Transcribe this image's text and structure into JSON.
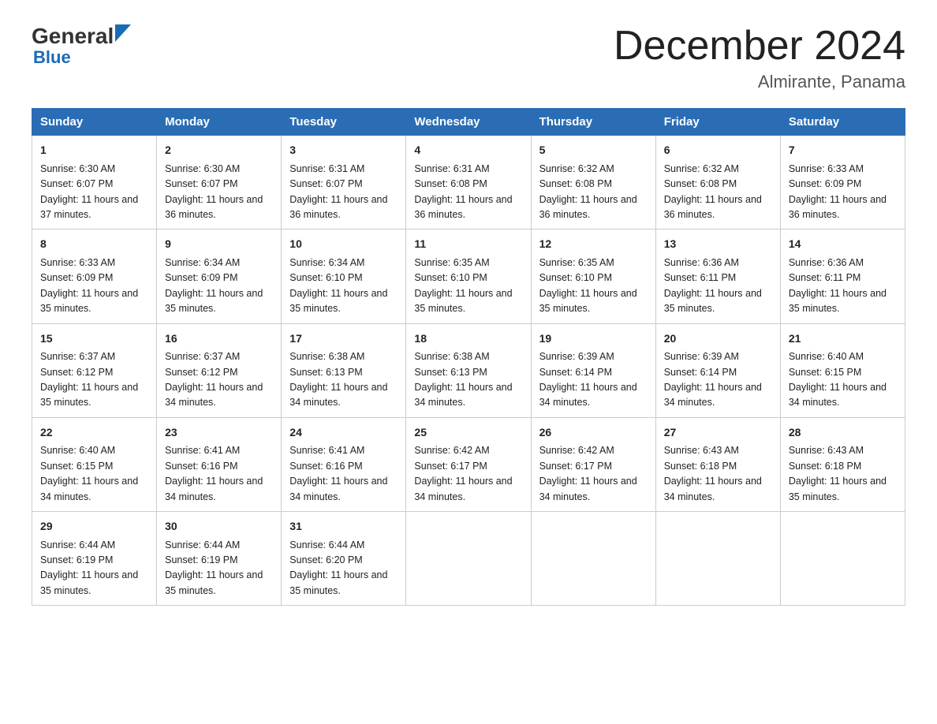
{
  "header": {
    "logo_general": "General",
    "logo_blue": "Blue",
    "month_title": "December 2024",
    "location": "Almirante, Panama"
  },
  "days_of_week": [
    "Sunday",
    "Monday",
    "Tuesday",
    "Wednesday",
    "Thursday",
    "Friday",
    "Saturday"
  ],
  "weeks": [
    [
      {
        "day": "1",
        "sunrise": "6:30 AM",
        "sunset": "6:07 PM",
        "daylight": "11 hours and 37 minutes."
      },
      {
        "day": "2",
        "sunrise": "6:30 AM",
        "sunset": "6:07 PM",
        "daylight": "11 hours and 36 minutes."
      },
      {
        "day": "3",
        "sunrise": "6:31 AM",
        "sunset": "6:07 PM",
        "daylight": "11 hours and 36 minutes."
      },
      {
        "day": "4",
        "sunrise": "6:31 AM",
        "sunset": "6:08 PM",
        "daylight": "11 hours and 36 minutes."
      },
      {
        "day": "5",
        "sunrise": "6:32 AM",
        "sunset": "6:08 PM",
        "daylight": "11 hours and 36 minutes."
      },
      {
        "day": "6",
        "sunrise": "6:32 AM",
        "sunset": "6:08 PM",
        "daylight": "11 hours and 36 minutes."
      },
      {
        "day": "7",
        "sunrise": "6:33 AM",
        "sunset": "6:09 PM",
        "daylight": "11 hours and 36 minutes."
      }
    ],
    [
      {
        "day": "8",
        "sunrise": "6:33 AM",
        "sunset": "6:09 PM",
        "daylight": "11 hours and 35 minutes."
      },
      {
        "day": "9",
        "sunrise": "6:34 AM",
        "sunset": "6:09 PM",
        "daylight": "11 hours and 35 minutes."
      },
      {
        "day": "10",
        "sunrise": "6:34 AM",
        "sunset": "6:10 PM",
        "daylight": "11 hours and 35 minutes."
      },
      {
        "day": "11",
        "sunrise": "6:35 AM",
        "sunset": "6:10 PM",
        "daylight": "11 hours and 35 minutes."
      },
      {
        "day": "12",
        "sunrise": "6:35 AM",
        "sunset": "6:10 PM",
        "daylight": "11 hours and 35 minutes."
      },
      {
        "day": "13",
        "sunrise": "6:36 AM",
        "sunset": "6:11 PM",
        "daylight": "11 hours and 35 minutes."
      },
      {
        "day": "14",
        "sunrise": "6:36 AM",
        "sunset": "6:11 PM",
        "daylight": "11 hours and 35 minutes."
      }
    ],
    [
      {
        "day": "15",
        "sunrise": "6:37 AM",
        "sunset": "6:12 PM",
        "daylight": "11 hours and 35 minutes."
      },
      {
        "day": "16",
        "sunrise": "6:37 AM",
        "sunset": "6:12 PM",
        "daylight": "11 hours and 34 minutes."
      },
      {
        "day": "17",
        "sunrise": "6:38 AM",
        "sunset": "6:13 PM",
        "daylight": "11 hours and 34 minutes."
      },
      {
        "day": "18",
        "sunrise": "6:38 AM",
        "sunset": "6:13 PM",
        "daylight": "11 hours and 34 minutes."
      },
      {
        "day": "19",
        "sunrise": "6:39 AM",
        "sunset": "6:14 PM",
        "daylight": "11 hours and 34 minutes."
      },
      {
        "day": "20",
        "sunrise": "6:39 AM",
        "sunset": "6:14 PM",
        "daylight": "11 hours and 34 minutes."
      },
      {
        "day": "21",
        "sunrise": "6:40 AM",
        "sunset": "6:15 PM",
        "daylight": "11 hours and 34 minutes."
      }
    ],
    [
      {
        "day": "22",
        "sunrise": "6:40 AM",
        "sunset": "6:15 PM",
        "daylight": "11 hours and 34 minutes."
      },
      {
        "day": "23",
        "sunrise": "6:41 AM",
        "sunset": "6:16 PM",
        "daylight": "11 hours and 34 minutes."
      },
      {
        "day": "24",
        "sunrise": "6:41 AM",
        "sunset": "6:16 PM",
        "daylight": "11 hours and 34 minutes."
      },
      {
        "day": "25",
        "sunrise": "6:42 AM",
        "sunset": "6:17 PM",
        "daylight": "11 hours and 34 minutes."
      },
      {
        "day": "26",
        "sunrise": "6:42 AM",
        "sunset": "6:17 PM",
        "daylight": "11 hours and 34 minutes."
      },
      {
        "day": "27",
        "sunrise": "6:43 AM",
        "sunset": "6:18 PM",
        "daylight": "11 hours and 34 minutes."
      },
      {
        "day": "28",
        "sunrise": "6:43 AM",
        "sunset": "6:18 PM",
        "daylight": "11 hours and 35 minutes."
      }
    ],
    [
      {
        "day": "29",
        "sunrise": "6:44 AM",
        "sunset": "6:19 PM",
        "daylight": "11 hours and 35 minutes."
      },
      {
        "day": "30",
        "sunrise": "6:44 AM",
        "sunset": "6:19 PM",
        "daylight": "11 hours and 35 minutes."
      },
      {
        "day": "31",
        "sunrise": "6:44 AM",
        "sunset": "6:20 PM",
        "daylight": "11 hours and 35 minutes."
      },
      null,
      null,
      null,
      null
    ]
  ]
}
